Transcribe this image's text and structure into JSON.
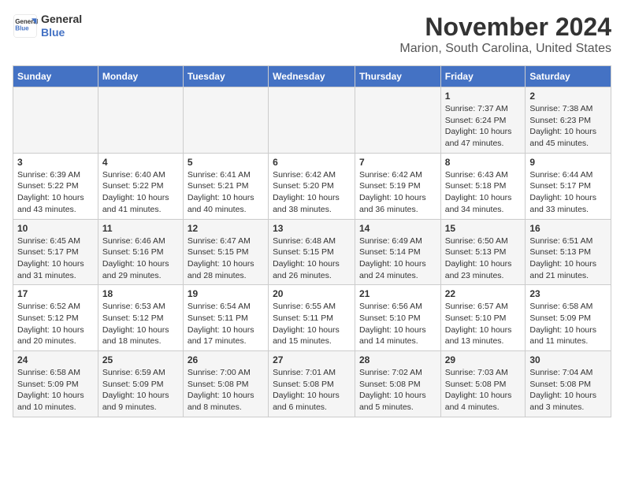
{
  "header": {
    "logo_line1": "General",
    "logo_line2": "Blue",
    "month": "November 2024",
    "location": "Marion, South Carolina, United States"
  },
  "days_of_week": [
    "Sunday",
    "Monday",
    "Tuesday",
    "Wednesday",
    "Thursday",
    "Friday",
    "Saturday"
  ],
  "weeks": [
    [
      {
        "day": "",
        "info": ""
      },
      {
        "day": "",
        "info": ""
      },
      {
        "day": "",
        "info": ""
      },
      {
        "day": "",
        "info": ""
      },
      {
        "day": "",
        "info": ""
      },
      {
        "day": "1",
        "info": "Sunrise: 7:37 AM\nSunset: 6:24 PM\nDaylight: 10 hours and 47 minutes."
      },
      {
        "day": "2",
        "info": "Sunrise: 7:38 AM\nSunset: 6:23 PM\nDaylight: 10 hours and 45 minutes."
      }
    ],
    [
      {
        "day": "3",
        "info": "Sunrise: 6:39 AM\nSunset: 5:22 PM\nDaylight: 10 hours and 43 minutes."
      },
      {
        "day": "4",
        "info": "Sunrise: 6:40 AM\nSunset: 5:22 PM\nDaylight: 10 hours and 41 minutes."
      },
      {
        "day": "5",
        "info": "Sunrise: 6:41 AM\nSunset: 5:21 PM\nDaylight: 10 hours and 40 minutes."
      },
      {
        "day": "6",
        "info": "Sunrise: 6:42 AM\nSunset: 5:20 PM\nDaylight: 10 hours and 38 minutes."
      },
      {
        "day": "7",
        "info": "Sunrise: 6:42 AM\nSunset: 5:19 PM\nDaylight: 10 hours and 36 minutes."
      },
      {
        "day": "8",
        "info": "Sunrise: 6:43 AM\nSunset: 5:18 PM\nDaylight: 10 hours and 34 minutes."
      },
      {
        "day": "9",
        "info": "Sunrise: 6:44 AM\nSunset: 5:17 PM\nDaylight: 10 hours and 33 minutes."
      }
    ],
    [
      {
        "day": "10",
        "info": "Sunrise: 6:45 AM\nSunset: 5:17 PM\nDaylight: 10 hours and 31 minutes."
      },
      {
        "day": "11",
        "info": "Sunrise: 6:46 AM\nSunset: 5:16 PM\nDaylight: 10 hours and 29 minutes."
      },
      {
        "day": "12",
        "info": "Sunrise: 6:47 AM\nSunset: 5:15 PM\nDaylight: 10 hours and 28 minutes."
      },
      {
        "day": "13",
        "info": "Sunrise: 6:48 AM\nSunset: 5:15 PM\nDaylight: 10 hours and 26 minutes."
      },
      {
        "day": "14",
        "info": "Sunrise: 6:49 AM\nSunset: 5:14 PM\nDaylight: 10 hours and 24 minutes."
      },
      {
        "day": "15",
        "info": "Sunrise: 6:50 AM\nSunset: 5:13 PM\nDaylight: 10 hours and 23 minutes."
      },
      {
        "day": "16",
        "info": "Sunrise: 6:51 AM\nSunset: 5:13 PM\nDaylight: 10 hours and 21 minutes."
      }
    ],
    [
      {
        "day": "17",
        "info": "Sunrise: 6:52 AM\nSunset: 5:12 PM\nDaylight: 10 hours and 20 minutes."
      },
      {
        "day": "18",
        "info": "Sunrise: 6:53 AM\nSunset: 5:12 PM\nDaylight: 10 hours and 18 minutes."
      },
      {
        "day": "19",
        "info": "Sunrise: 6:54 AM\nSunset: 5:11 PM\nDaylight: 10 hours and 17 minutes."
      },
      {
        "day": "20",
        "info": "Sunrise: 6:55 AM\nSunset: 5:11 PM\nDaylight: 10 hours and 15 minutes."
      },
      {
        "day": "21",
        "info": "Sunrise: 6:56 AM\nSunset: 5:10 PM\nDaylight: 10 hours and 14 minutes."
      },
      {
        "day": "22",
        "info": "Sunrise: 6:57 AM\nSunset: 5:10 PM\nDaylight: 10 hours and 13 minutes."
      },
      {
        "day": "23",
        "info": "Sunrise: 6:58 AM\nSunset: 5:09 PM\nDaylight: 10 hours and 11 minutes."
      }
    ],
    [
      {
        "day": "24",
        "info": "Sunrise: 6:58 AM\nSunset: 5:09 PM\nDaylight: 10 hours and 10 minutes."
      },
      {
        "day": "25",
        "info": "Sunrise: 6:59 AM\nSunset: 5:09 PM\nDaylight: 10 hours and 9 minutes."
      },
      {
        "day": "26",
        "info": "Sunrise: 7:00 AM\nSunset: 5:08 PM\nDaylight: 10 hours and 8 minutes."
      },
      {
        "day": "27",
        "info": "Sunrise: 7:01 AM\nSunset: 5:08 PM\nDaylight: 10 hours and 6 minutes."
      },
      {
        "day": "28",
        "info": "Sunrise: 7:02 AM\nSunset: 5:08 PM\nDaylight: 10 hours and 5 minutes."
      },
      {
        "day": "29",
        "info": "Sunrise: 7:03 AM\nSunset: 5:08 PM\nDaylight: 10 hours and 4 minutes."
      },
      {
        "day": "30",
        "info": "Sunrise: 7:04 AM\nSunset: 5:08 PM\nDaylight: 10 hours and 3 minutes."
      }
    ]
  ]
}
